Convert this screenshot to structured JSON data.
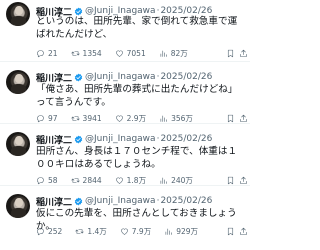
{
  "author": {
    "name": "稲川淳二",
    "handle": "@Junji_Inagawa"
  },
  "tweets": [
    {
      "date": "2025/02/26",
      "text": "というのは、田所先輩、家で倒れて救急車で運ばれたんだけど、",
      "replies": "21",
      "retweets": "1354",
      "likes": "7051",
      "views": "82万"
    },
    {
      "date": "2025/02/26",
      "text": "「俺さあ、田所先輩の葬式に出たんだけどね」って言うんです。",
      "replies": "97",
      "retweets": "3941",
      "likes": "2.9万",
      "views": "356万"
    },
    {
      "date": "2025/02/26",
      "text": "田所さん、身長は１７０センチ程で、体重は１００キロはあるでしょうね。",
      "replies": "58",
      "retweets": "2844",
      "likes": "1.8万",
      "views": "240万"
    },
    {
      "date": "2025/02/26",
      "text": "仮にこの先輩を、田所さんとしておきましょうか。",
      "replies": "252",
      "retweets": "1.4万",
      "likes": "7.9万",
      "views": "929万"
    }
  ],
  "date_prefix": "· ",
  "icons": {
    "verified": "verified-badge-icon",
    "reply": "reply-icon",
    "retweet": "retweet-icon",
    "like": "heart-icon",
    "views": "views-bar-chart-icon",
    "bookmark": "bookmark-icon",
    "share": "share-icon"
  },
  "colors": {
    "text": "#0f1419",
    "secondary": "#536471",
    "verified": "#1d9bf0"
  }
}
